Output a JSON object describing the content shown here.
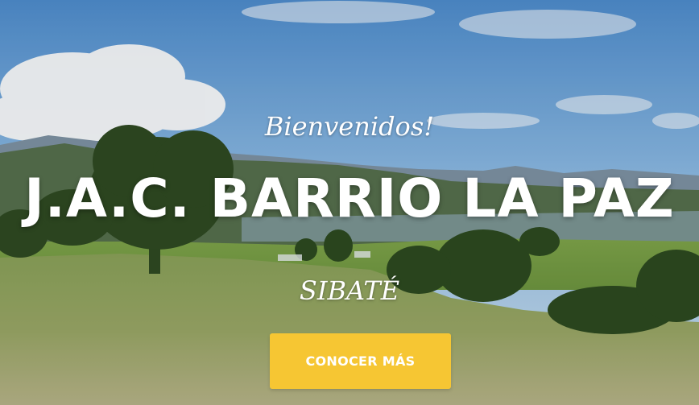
{
  "hero": {
    "welcome": "Bienvenidos!",
    "title": "J.A.C. BARRIO LA PAZ",
    "subtitle": "SIBATÉ",
    "cta_label": "CONOCER MÁS",
    "cta_color": "#f6c633",
    "background": "landscape-photo"
  }
}
